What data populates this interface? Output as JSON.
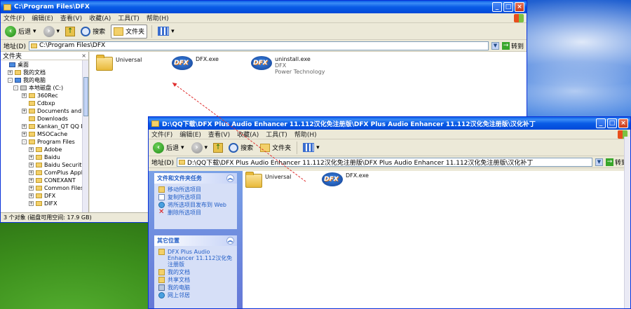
{
  "win1": {
    "title": "C:\\Program Files\\DFX",
    "menu": [
      "文件(F)",
      "编辑(E)",
      "查看(V)",
      "收藏(A)",
      "工具(T)",
      "帮助(H)"
    ],
    "toolbar": {
      "back": "后退",
      "search": "搜索",
      "folders": "文件夹"
    },
    "address_label": "地址(D)",
    "address": "C:\\Program Files\\DFX",
    "go": "转到",
    "pane_title": "文件夹",
    "tree": [
      {
        "label": "桌面",
        "icon": "blue",
        "expand": ""
      },
      {
        "label": "我的文档",
        "icon": "folder",
        "expand": "+"
      },
      {
        "label": "我的电脑",
        "icon": "blue",
        "expand": "-"
      },
      {
        "label": "本地磁盘 (C:)",
        "icon": "drive",
        "expand": "-"
      },
      {
        "label": "360Rec",
        "icon": "folder",
        "expand": "+"
      },
      {
        "label": "Cdbxp",
        "icon": "folder",
        "expand": ""
      },
      {
        "label": "Documents and Set",
        "icon": "folder",
        "expand": "+"
      },
      {
        "label": "Downloads",
        "icon": "folder",
        "expand": ""
      },
      {
        "label": "Kankan_QT QQ Down",
        "icon": "folder",
        "expand": "+"
      },
      {
        "label": "MSOCache",
        "icon": "folder",
        "expand": "+"
      },
      {
        "label": "Program Files",
        "icon": "folder",
        "expand": "-"
      },
      {
        "label": "Adobe",
        "icon": "folder",
        "expand": "+"
      },
      {
        "label": "Baidu",
        "icon": "folder",
        "expand": "+"
      },
      {
        "label": "Baidu Security",
        "icon": "folder",
        "expand": "+"
      },
      {
        "label": "ComPlus Applications",
        "icon": "folder",
        "expand": "+"
      },
      {
        "label": "CONEXANT",
        "icon": "folder",
        "expand": "+"
      },
      {
        "label": "Common Files",
        "icon": "folder",
        "expand": "+"
      },
      {
        "label": "DFX",
        "icon": "folder",
        "expand": "+"
      },
      {
        "label": "DIFX",
        "icon": "folder",
        "expand": "+"
      }
    ],
    "files": [
      {
        "name": "Universal",
        "sub1": "",
        "sub2": "",
        "type": "folder"
      },
      {
        "name": "DFX.exe",
        "sub1": "",
        "sub2": "",
        "type": "dfx"
      },
      {
        "name": "uninstall.exe",
        "sub1": "DFX",
        "sub2": "Power Technology",
        "type": "dfx"
      }
    ],
    "status": "3 个对象 (磁盘可用空间: 17.9 GB)"
  },
  "win2": {
    "title": "D:\\QQ下载\\DFX Plus Audio Enhancer 11.112汉化免注册版\\DFX Plus Audio Enhancer 11.112汉化免注册版\\汉化补丁",
    "menu": [
      "文件(F)",
      "编辑(E)",
      "查看(V)",
      "收藏(A)",
      "工具(T)",
      "帮助(H)"
    ],
    "toolbar": {
      "back": "后退",
      "search": "搜索",
      "folders": "文件夹"
    },
    "address_label": "地址(D)",
    "address": "D:\\QQ下载\\DFX Plus Audio Enhancer 11.112汉化免注册版\\DFX Plus Audio Enhancer 11.112汉化免注册版\\汉化补丁",
    "go": "转到",
    "task_group1": {
      "title": "文件和文件夹任务",
      "items": [
        "移动所选项目",
        "复制所选项目",
        "将所选项目发布到 Web",
        "删除所选项目"
      ]
    },
    "task_group2": {
      "title": "其它位置",
      "items": [
        "DFX Plus Audio Enhancer 11.112汉化免注册版",
        "我的文档",
        "共享文档",
        "我的电脑",
        "网上邻居"
      ]
    },
    "files": [
      {
        "name": "Universal",
        "type": "folder"
      },
      {
        "name": "DFX.exe",
        "type": "dfx"
      }
    ]
  }
}
